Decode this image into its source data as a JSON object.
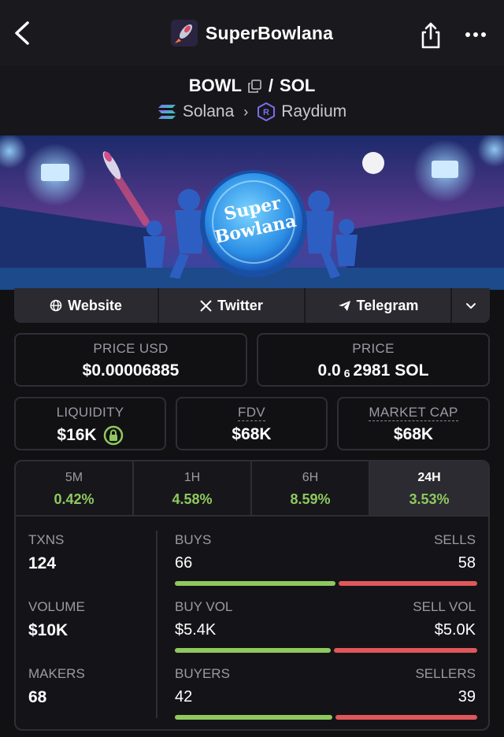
{
  "nav": {
    "title": "SuperBowlana",
    "back_icon": "chevron-left-icon",
    "share_icon": "share-icon",
    "more_icon": "more-dots-icon"
  },
  "pair": {
    "base": "BOWL",
    "separator": "/",
    "quote": "SOL",
    "chain": "Solana",
    "dex": "Raydium"
  },
  "banner": {
    "coin_text_line1": "Super",
    "coin_text_line2": "Bowlana"
  },
  "links": {
    "website": "Website",
    "twitter": "Twitter",
    "telegram": "Telegram"
  },
  "price": {
    "usd_label": "PRICE USD",
    "usd_value": "$0.00006885",
    "native_label": "PRICE",
    "native_prefix": "0.0",
    "native_zeros": "6",
    "native_digits": "2981",
    "native_unit": "SOL"
  },
  "metrics": {
    "liquidity_label": "LIQUIDITY",
    "liquidity_value": "$16K",
    "fdv_label": "FDV",
    "fdv_value": "$68K",
    "mcap_label": "MARKET CAP",
    "mcap_value": "$68K"
  },
  "tabs": [
    {
      "label": "5M",
      "value": "0.42%"
    },
    {
      "label": "1H",
      "value": "4.58%"
    },
    {
      "label": "6H",
      "value": "8.59%"
    },
    {
      "label": "24H",
      "value": "3.53%"
    }
  ],
  "stats": {
    "txns_label": "TXNS",
    "txns_value": "124",
    "buys_label": "BUYS",
    "buys_value": "66",
    "sells_label": "SELLS",
    "sells_value": "58",
    "volume_label": "VOLUME",
    "volume_value": "$10K",
    "buyvol_label": "BUY VOL",
    "buyvol_value": "$5.4K",
    "sellvol_label": "SELL VOL",
    "sellvol_value": "$5.0K",
    "makers_label": "MAKERS",
    "makers_value": "68",
    "buyers_label": "BUYERS",
    "buyers_value": "42",
    "sellers_label": "SELLERS",
    "sellers_value": "39"
  },
  "colors": {
    "positive": "#8fc95d",
    "negative": "#e0575b",
    "background": "#111114"
  }
}
